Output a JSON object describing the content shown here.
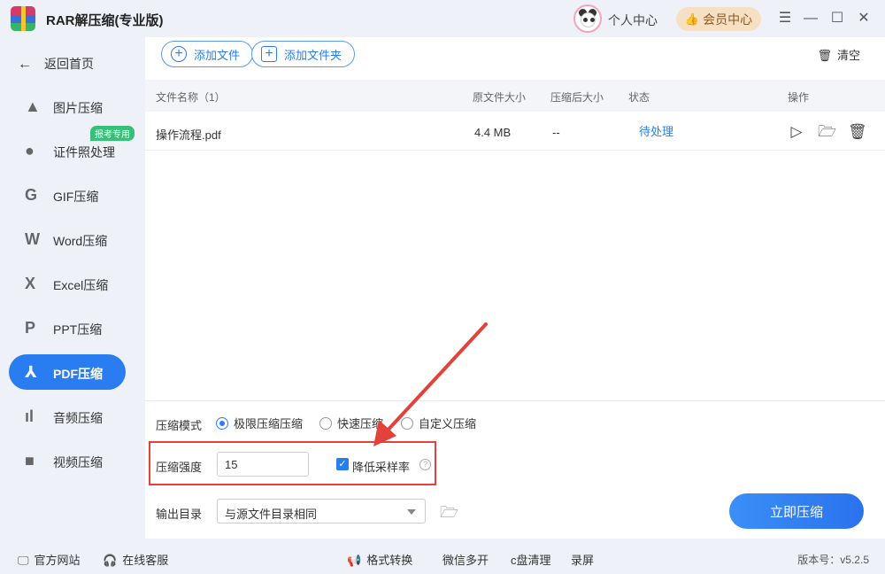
{
  "app": {
    "title": "RAR解压缩(专业版)"
  },
  "header": {
    "personal_center": "个人中心",
    "vip_center": "会员中心"
  },
  "sidebar": {
    "back_label": "返回首页",
    "tag_label": "报考专用",
    "items": [
      {
        "label": "图片压缩",
        "icon": "image-icon"
      },
      {
        "label": "证件照处理",
        "icon": "id-photo-icon"
      },
      {
        "label": "GIF压缩",
        "icon": "gif-icon"
      },
      {
        "label": "Word压缩",
        "icon": "word-icon"
      },
      {
        "label": "Excel压缩",
        "icon": "excel-icon"
      },
      {
        "label": "PPT压缩",
        "icon": "ppt-icon"
      },
      {
        "label": "PDF压缩",
        "icon": "pdf-icon",
        "active": true
      },
      {
        "label": "音频压缩",
        "icon": "audio-icon"
      },
      {
        "label": "视频压缩",
        "icon": "video-icon"
      }
    ]
  },
  "toolbar": {
    "add_file": "添加文件",
    "add_folder": "添加文件夹",
    "clear": "清空"
  },
  "table": {
    "headers": {
      "name": "文件名称（1）",
      "original_size": "原文件大小",
      "compressed_size": "压缩后大小",
      "status": "状态",
      "actions": "操作"
    },
    "rows": [
      {
        "name": "操作流程.pdf",
        "original_size": "4.4 MB",
        "compressed_size": "--",
        "status": "待处理"
      }
    ]
  },
  "options": {
    "mode_label": "压缩模式",
    "modes": [
      "极限压缩压缩",
      "快速压缩",
      "自定义压缩"
    ],
    "selected_mode": "极限压缩压缩",
    "strength_label": "压缩强度",
    "strength_value": "15",
    "reduce_sampling_label": "降低采样率",
    "reduce_sampling_checked": true,
    "help_symbol": "?",
    "output_label": "输出目录",
    "output_value": "与源文件目录相同",
    "compress_button": "立即压缩"
  },
  "footer": {
    "official_site": "官方网站",
    "online_service": "在线客服",
    "format_convert": "格式转换",
    "wechat_multi": "微信多开",
    "c_drive_clean": "c盘清理",
    "screen_record": "录屏",
    "version": "版本号：v5.2.5"
  },
  "colors": {
    "accent": "#2a7df1",
    "highlight_box": "#e3423b",
    "tag": "#38c07a",
    "vip": "#f6dfc3"
  }
}
